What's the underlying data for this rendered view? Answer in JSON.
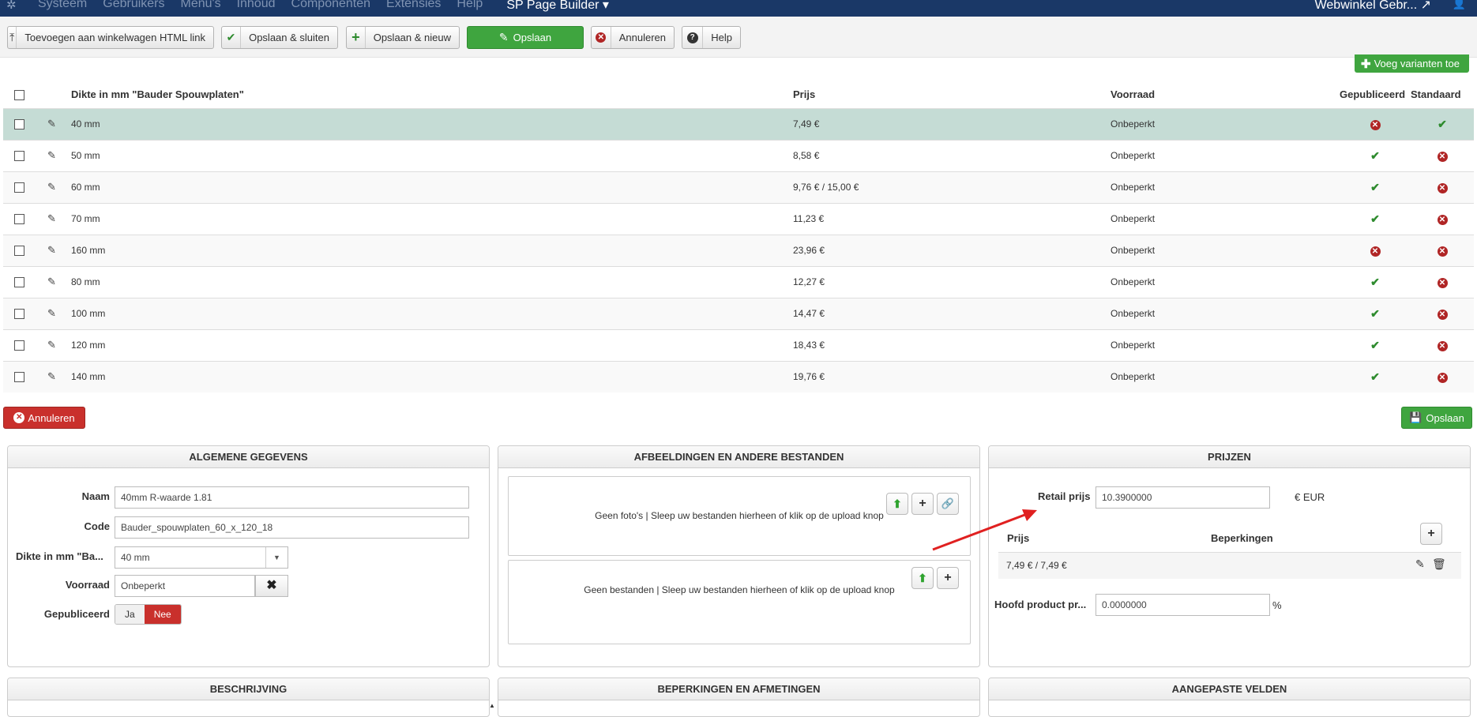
{
  "topnav": {
    "menu": [
      "Systeem",
      "Gebruikers",
      "Menu's",
      "Inhoud",
      "Componenten",
      "Extensies",
      "Help"
    ],
    "sp_page_builder": "SP Page Builder ▾",
    "site_name": "Webwinkel Gebr...",
    "user_icon": "user-icon"
  },
  "toolbar": {
    "add_cart_link": "Toevoegen aan winkelwagen HTML link",
    "save_close": "Opslaan & sluiten",
    "save_new": "Opslaan & nieuw",
    "save": "Opslaan",
    "cancel": "Annuleren",
    "help": "Help"
  },
  "add_variants": "Voeg varianten toe",
  "table": {
    "headers": {
      "dikte": "Dikte in mm \"Bauder Spouwplaten\"",
      "prijs": "Prijs",
      "voorraad": "Voorraad",
      "gepubliceerd": "Gepubliceerd",
      "standaard": "Standaard"
    },
    "rows": [
      {
        "dikte": "40 mm",
        "prijs": "7,49 €",
        "voorraad": "Onbeperkt",
        "published": false,
        "default": true
      },
      {
        "dikte": "50 mm",
        "prijs": "8,58 €",
        "voorraad": "Onbeperkt",
        "published": true,
        "default": false
      },
      {
        "dikte": "60 mm",
        "prijs": "9,76 € / 15,00 €",
        "voorraad": "Onbeperkt",
        "published": true,
        "default": false
      },
      {
        "dikte": "70 mm",
        "prijs": "11,23 €",
        "voorraad": "Onbeperkt",
        "published": true,
        "default": false
      },
      {
        "dikte": "160 mm",
        "prijs": "23,96 €",
        "voorraad": "Onbeperkt",
        "published": false,
        "default": false
      },
      {
        "dikte": "80 mm",
        "prijs": "12,27 €",
        "voorraad": "Onbeperkt",
        "published": true,
        "default": false
      },
      {
        "dikte": "100 mm",
        "prijs": "14,47 €",
        "voorraad": "Onbeperkt",
        "published": true,
        "default": false
      },
      {
        "dikte": "120 mm",
        "prijs": "18,43 €",
        "voorraad": "Onbeperkt",
        "published": true,
        "default": false
      },
      {
        "dikte": "140 mm",
        "prijs": "19,76 €",
        "voorraad": "Onbeperkt",
        "published": true,
        "default": false
      }
    ]
  },
  "bottom": {
    "cancel": "Annuleren",
    "save": "Opslaan"
  },
  "general": {
    "title": "ALGEMENE GEGEVENS",
    "naam_label": "Naam",
    "naam_value": "40mm R-waarde 1.81",
    "code_label": "Code",
    "code_value": "Bauder_spouwplaten_60_x_120_18",
    "dikte_label": "Dikte in mm \"Ba...",
    "dikte_value": "40 mm",
    "voorraad_label": "Voorraad",
    "voorraad_value": "Onbeperkt",
    "gepubliceerd_label": "Gepubliceerd",
    "ja": "Ja",
    "nee": "Nee"
  },
  "images": {
    "title": "AFBEELDINGEN EN ANDERE BESTANDEN",
    "no_photos": "Geen foto's | Sleep uw bestanden hierheen of klik op de upload knop",
    "no_files": "Geen bestanden | Sleep uw bestanden hierheen of klik op de upload knop"
  },
  "prices": {
    "title": "PRIJZEN",
    "retail_label": "Retail prijs",
    "retail_value": "10.3900000",
    "currency": "€ EUR",
    "col_prijs": "Prijs",
    "col_beperkingen": "Beperkingen",
    "row_value": "7,49 € / 7,49 €",
    "hoofd_label": "Hoofd product pr...",
    "hoofd_value": "0.0000000",
    "percent": "%"
  },
  "lower_panels": {
    "beschrijving": "BESCHRIJVING",
    "beperkingen": "BEPERKINGEN EN AFMETINGEN",
    "aangepaste": "AANGEPASTE VELDEN"
  },
  "colors": {
    "nav": "#1a3867",
    "green": "#3fa53f",
    "red": "#c9302c",
    "selected_row": "#c5dcd5"
  }
}
